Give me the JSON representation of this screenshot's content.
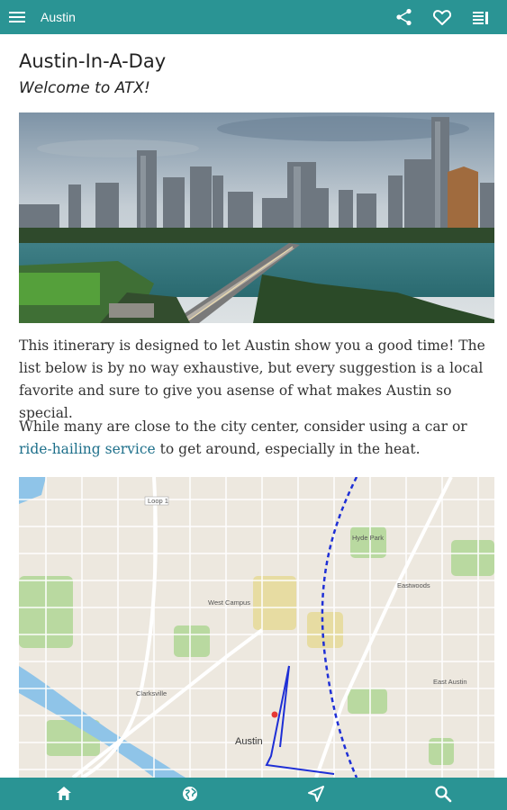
{
  "app": {
    "title": "Austin"
  },
  "icons": {
    "menu": "hamburger-menu-icon",
    "share": "share-icon",
    "favorite": "heart-icon",
    "toc": "list-icon",
    "home": "home-icon",
    "globe": "globe-icon",
    "nearby": "navigation-arrow-icon",
    "search": "search-icon"
  },
  "article": {
    "title": "Austin-In-A-Day",
    "subtitle": "Welcome to ATX!",
    "para1": "This itinerary is designed to let Austin show you a good time! The list below is by no way exhaustive, but every suggestion is a local favorite and sure to give you asense of what makes Austin so special.",
    "para2_before": "While many are close to the city center, consider using a car or ",
    "para2_link": "ride-hailing service",
    "para2_after": " to get around, especially in the heat."
  },
  "map": {
    "labels": {
      "loop": "Loop 1",
      "west_campus": "West Campus",
      "austin": "Austin",
      "clarksville": "Clarksville",
      "eastwoods": "Eastwoods",
      "east_austin": "East Austin",
      "hyde_park": "Hyde Park"
    }
  },
  "colors": {
    "accent": "#2a9494",
    "link": "#1d6f8a",
    "route": "#1e2fd6"
  }
}
